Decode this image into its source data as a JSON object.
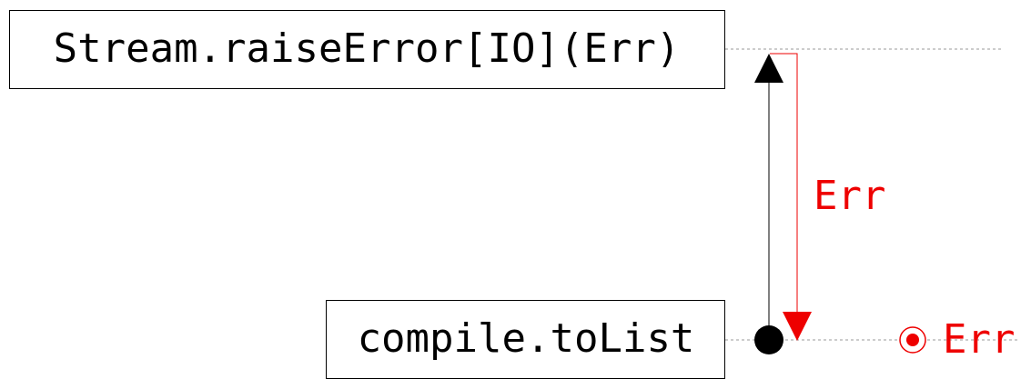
{
  "diagram": {
    "top_node": {
      "label": "Stream.raiseError[IO](Err)"
    },
    "bottom_node": {
      "label": "compile.toList"
    },
    "error_edge": {
      "label": "Err"
    },
    "result": {
      "label": "Err"
    }
  },
  "colors": {
    "error": "#ee0000",
    "box_border": "#000000",
    "text": "#000000",
    "guide_line": "#999999",
    "background": "#ffffff"
  }
}
